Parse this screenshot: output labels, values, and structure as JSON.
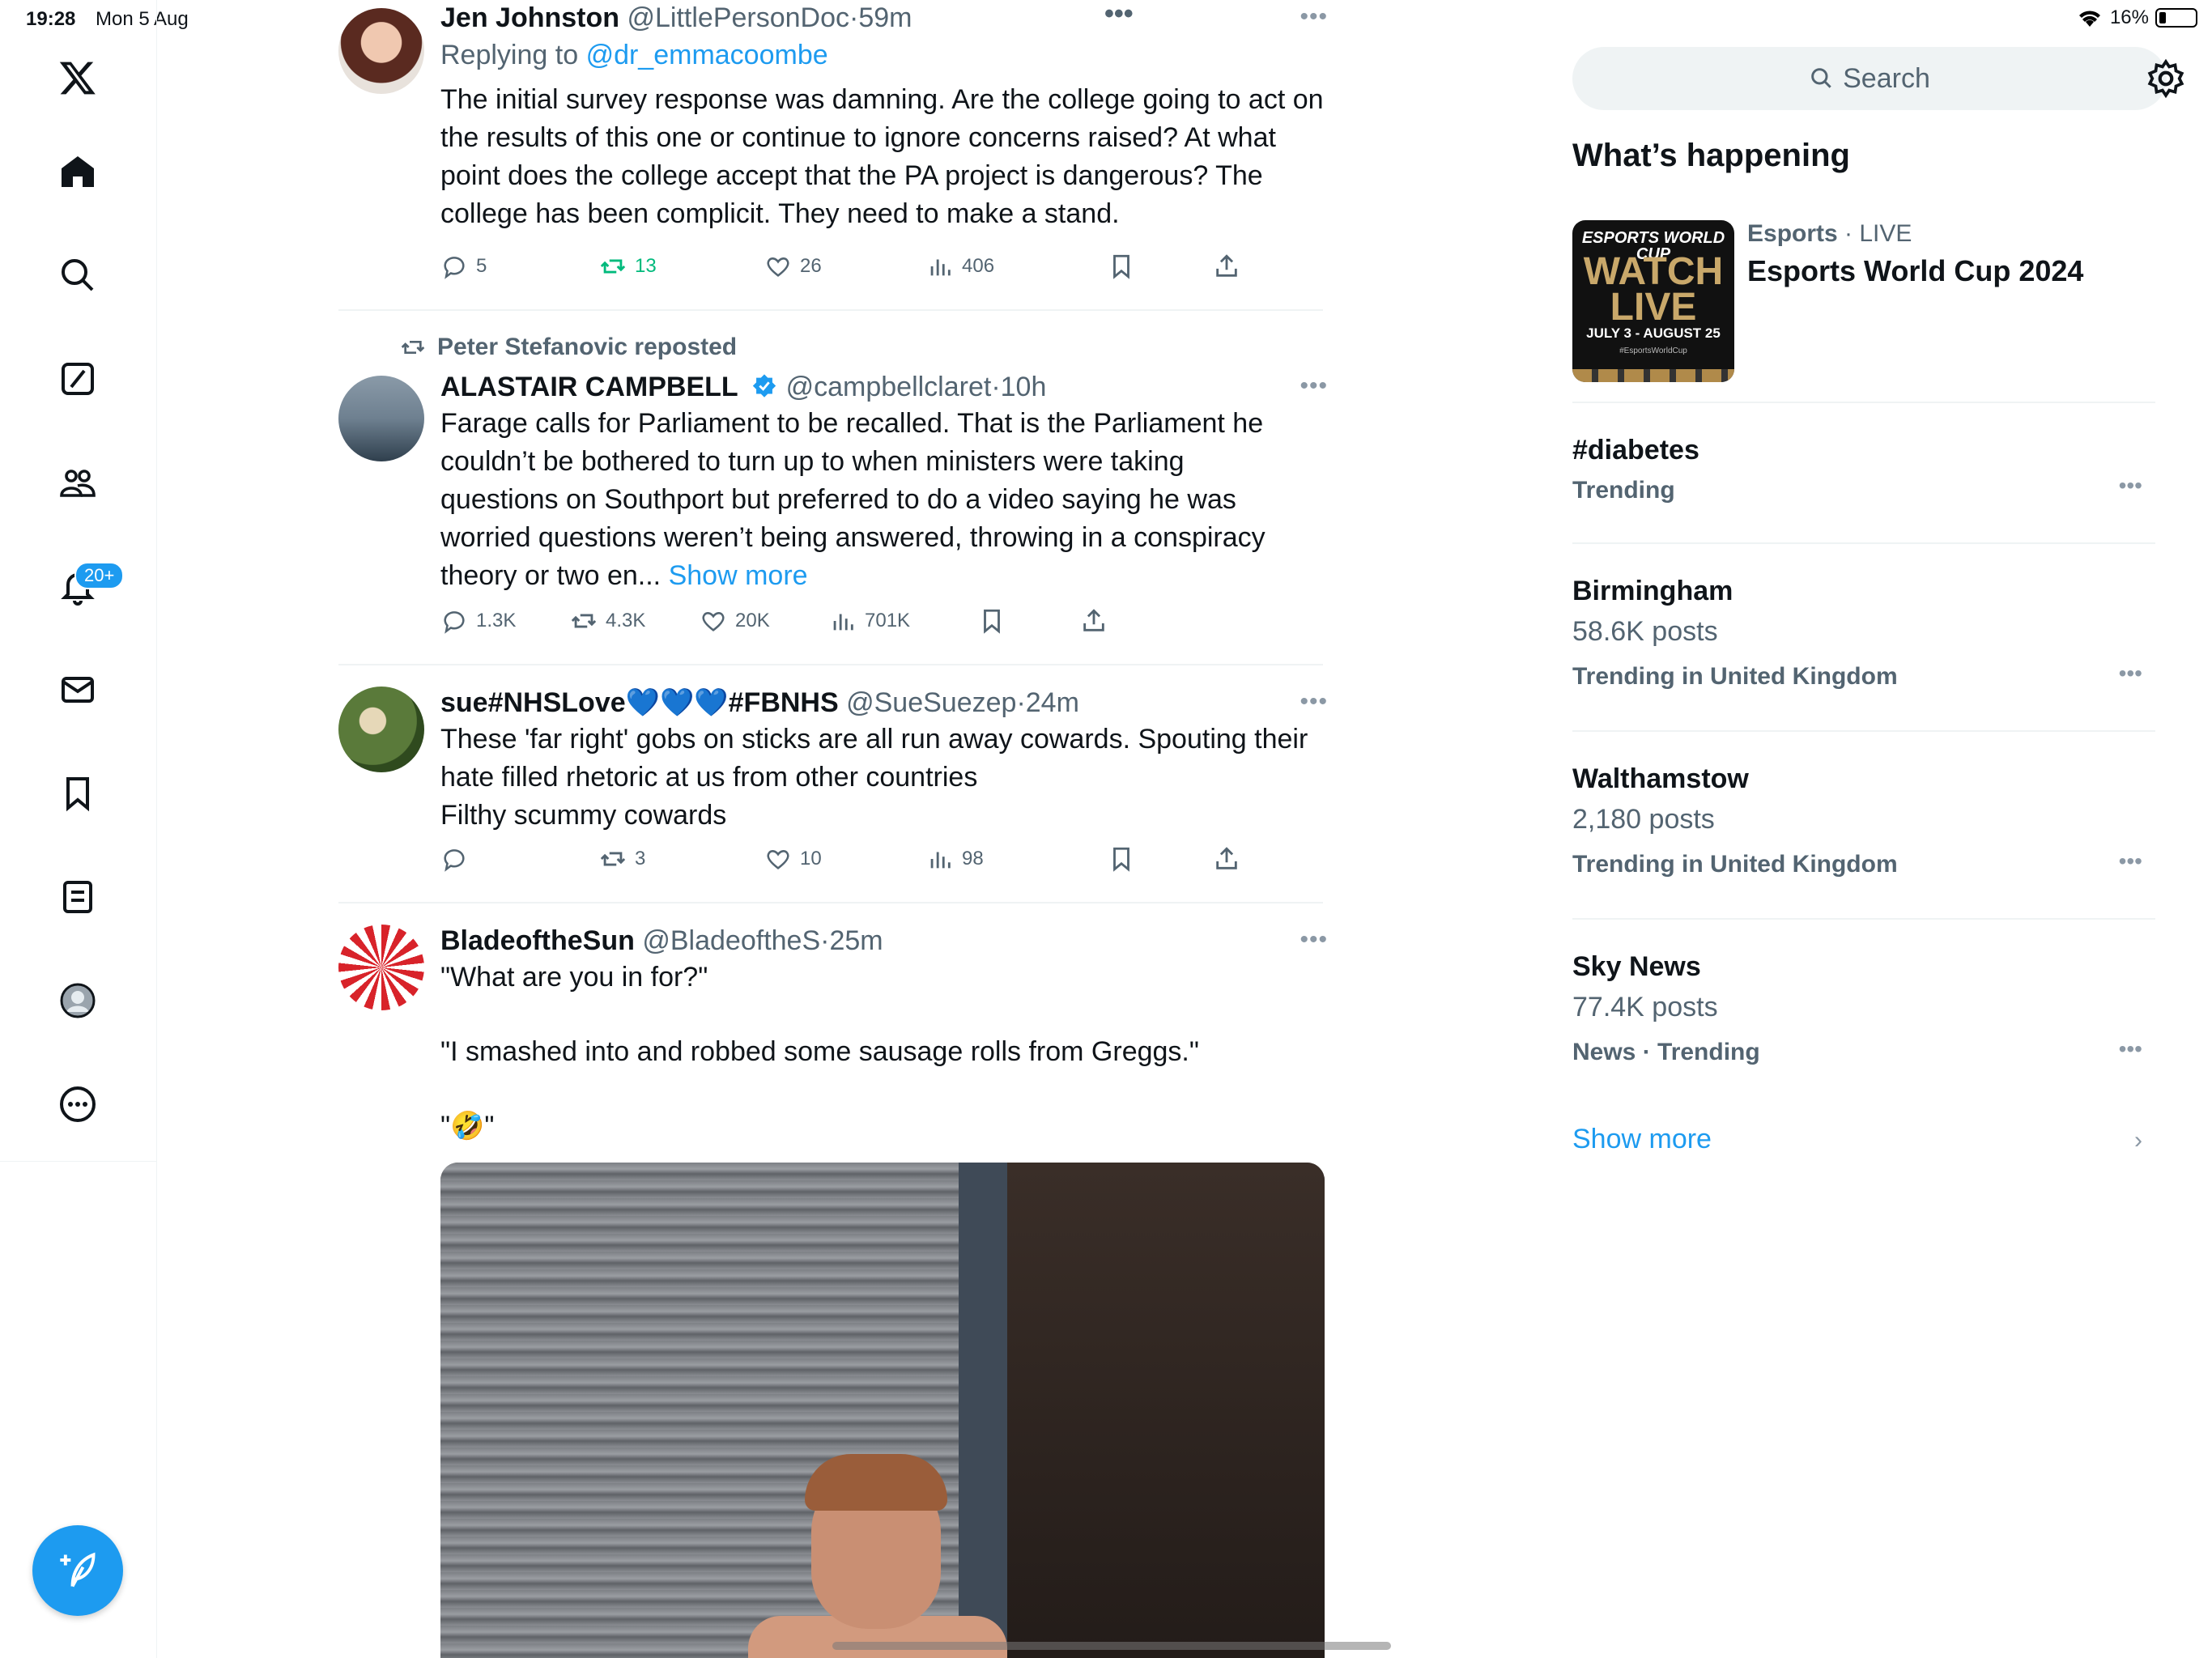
{
  "status_bar": {
    "time": "19:28",
    "date": "Mon 5 Aug",
    "battery": "16%"
  },
  "nav": {
    "notifications_badge": "20+",
    "items": [
      "Home",
      "Explore",
      "Grok",
      "Communities",
      "Notifications",
      "Messages",
      "Bookmarks",
      "Lists",
      "Profile",
      "More"
    ]
  },
  "tweets": [
    {
      "name": "Jen Johnston",
      "handle": "@LittlePersonDoc",
      "time": "·59m",
      "replying_label": "Replying to",
      "replying_to": "@dr_emmacoombe",
      "text": "The initial survey response was damning. Are the college going to act on\nthe results of this one or continue to ignore concerns raised? At what\npoint does the college accept that the PA project is dangerous? The\ncollege has been complicit. They need to make a stand.",
      "replies": "5",
      "reposts": "13",
      "likes": "26",
      "views": "406"
    },
    {
      "repost_by": "Peter Stefanovic reposted",
      "name": "ALASTAIR CAMPBELL",
      "handle": "@campbellclaret",
      "time": "·10h",
      "text": "Farage calls for Parliament to be recalled. That is the Parliament he\ncouldn’t be bothered to turn up to when ministers were taking\nquestions on Southport but preferred to do a video saying he was\nworried questions weren’t being answered, throwing in a conspiracy\ntheory or two en...",
      "show_more": "Show more",
      "replies": "1.3K",
      "reposts": "4.3K",
      "likes": "20K",
      "views": "701K"
    },
    {
      "name": "sue#NHSLove💙💙💙#FBNHS",
      "handle": "@SueSuezep",
      "time": "·24m",
      "text": "These 'far right' gobs on sticks are all run away cowards. Spouting their\nhate filled rhetoric at us from other countries\nFilthy scummy cowards",
      "replies": "",
      "reposts": "3",
      "likes": "10",
      "views": "98"
    },
    {
      "name": "BladeoftheSun",
      "handle": "@BladeoftheS",
      "time": "·25m",
      "text": "\"What are you in for?\"\n\n\"I smashed into and robbed some sausage rolls from Greggs.\"\n\n\"🤣\""
    }
  ],
  "sidebar": {
    "search_placeholder": "Search",
    "section_title": "What’s happening",
    "esports": {
      "category": "Esports",
      "live": "· LIVE",
      "title": "Esports World Cup 2024",
      "thumb_line1": "ESPORTS WORLD CUP",
      "thumb_line2": "WATCH LIVE",
      "thumb_line3": "JULY 3 - AUGUST 25",
      "thumb_line4": "#EsportsWorldCup"
    },
    "trends": [
      {
        "name": "#diabetes",
        "posts": "",
        "context": "Trending"
      },
      {
        "name": "Birmingham",
        "posts": "58.6K posts",
        "context": "Trending in United Kingdom"
      },
      {
        "name": "Walthamstow",
        "posts": "2,180 posts",
        "context": "Trending in United Kingdom"
      },
      {
        "name": "Sky News",
        "posts": "77.4K posts",
        "context": "News · Trending"
      }
    ],
    "show_more": "Show more"
  },
  "colors": {
    "accent": "#1d9bf0",
    "repost_green": "#00ba7c",
    "muted": "#536471",
    "divider": "#eff3f4"
  }
}
